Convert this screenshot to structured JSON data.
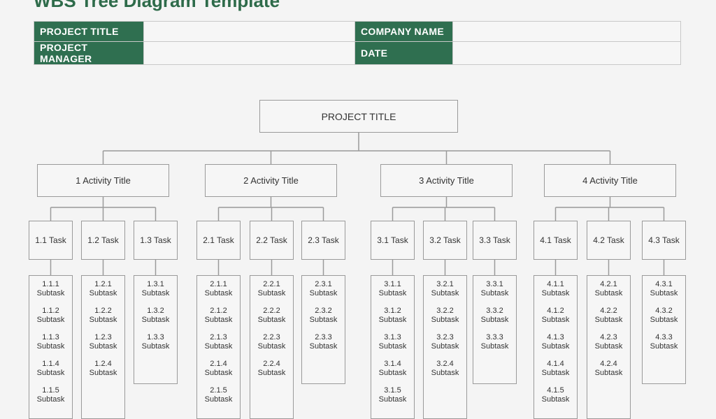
{
  "document": {
    "title": "WBS Tree Diagram Template"
  },
  "info": {
    "project_title_label": "PROJECT TITLE",
    "project_title_value": "",
    "company_name_label": "COMPANY NAME",
    "company_name_value": "",
    "project_manager_label": "PROJECT MANAGER",
    "project_manager_value": "",
    "date_label": "DATE",
    "date_value": ""
  },
  "colors": {
    "accent": "#2f6f50",
    "border": "#9a9a9a",
    "background": "#f4f4f4"
  },
  "tree": {
    "root": "PROJECT TITLE",
    "activities": [
      {
        "label": "1 Activity Title",
        "tasks": [
          {
            "label": "1.1 Task",
            "subtasks": [
              [
                "1.1.1",
                "Subtask"
              ],
              [
                "1.1.2",
                "Subtask"
              ],
              [
                "1.1.3",
                "Subtask"
              ],
              [
                "1.1.4",
                "Subtask"
              ],
              [
                "1.1.5",
                "Subtask"
              ]
            ]
          },
          {
            "label": "1.2 Task",
            "subtasks": [
              [
                "1.2.1",
                "Subtask"
              ],
              [
                "1.2.2",
                "Subtask"
              ],
              [
                "1.2.3",
                "Subtask"
              ],
              [
                "1.2.4",
                "Subtask"
              ]
            ]
          },
          {
            "label": "1.3 Task",
            "subtasks": [
              [
                "1.3.1",
                "Subtask"
              ],
              [
                "1.3.2",
                "Subtask"
              ],
              [
                "1.3.3",
                "Subtask"
              ]
            ]
          }
        ]
      },
      {
        "label": "2 Activity Title",
        "tasks": [
          {
            "label": "2.1 Task",
            "subtasks": [
              [
                "2.1.1",
                "Subtask"
              ],
              [
                "2.1.2",
                "Subtask"
              ],
              [
                "2.1.3",
                "Subtask"
              ],
              [
                "2.1.4",
                "Subtask"
              ],
              [
                "2.1.5",
                "Subtask"
              ]
            ]
          },
          {
            "label": "2.2 Task",
            "subtasks": [
              [
                "2.2.1",
                "Subtask"
              ],
              [
                "2.2.2",
                "Subtask"
              ],
              [
                "2.2.3",
                "Subtask"
              ],
              [
                "2.2.4",
                "Subtask"
              ]
            ]
          },
          {
            "label": "2.3 Task",
            "subtasks": [
              [
                "2.3.1",
                "Subtask"
              ],
              [
                "2.3.2",
                "Subtask"
              ],
              [
                "2.3.3",
                "Subtask"
              ]
            ]
          }
        ]
      },
      {
        "label": "3 Activity Title",
        "tasks": [
          {
            "label": "3.1 Task",
            "subtasks": [
              [
                "3.1.1",
                "Subtask"
              ],
              [
                "3.1.2",
                "Subtask"
              ],
              [
                "3.1.3",
                "Subtask"
              ],
              [
                "3.1.4",
                "Subtask"
              ],
              [
                "3.1.5",
                "Subtask"
              ]
            ]
          },
          {
            "label": "3.2 Task",
            "subtasks": [
              [
                "3.2.1",
                "Subtask"
              ],
              [
                "3.2.2",
                "Subtask"
              ],
              [
                "3.2.3",
                "Subtask"
              ],
              [
                "3.2.4",
                "Subtask"
              ]
            ]
          },
          {
            "label": "3.3 Task",
            "subtasks": [
              [
                "3.3.1",
                "Subtask"
              ],
              [
                "3.3.2",
                "Subtask"
              ],
              [
                "3.3.3",
                "Subtask"
              ]
            ]
          }
        ]
      },
      {
        "label": "4 Activity Title",
        "tasks": [
          {
            "label": "4.1 Task",
            "subtasks": [
              [
                "4.1.1",
                "Subtask"
              ],
              [
                "4.1.2",
                "Subtask"
              ],
              [
                "4.1.3",
                "Subtask"
              ],
              [
                "4.1.4",
                "Subtask"
              ],
              [
                "4.1.5",
                "Subtask"
              ]
            ]
          },
          {
            "label": "4.2 Task",
            "subtasks": [
              [
                "4.2.1",
                "Subtask"
              ],
              [
                "4.2.2",
                "Subtask"
              ],
              [
                "4.2.3",
                "Subtask"
              ],
              [
                "4.2.4",
                "Subtask"
              ]
            ]
          },
          {
            "label": "4.3 Task",
            "subtasks": [
              [
                "4.3.1",
                "Subtask"
              ],
              [
                "4.3.2",
                "Subtask"
              ],
              [
                "4.3.3",
                "Subtask"
              ]
            ]
          }
        ]
      }
    ]
  }
}
